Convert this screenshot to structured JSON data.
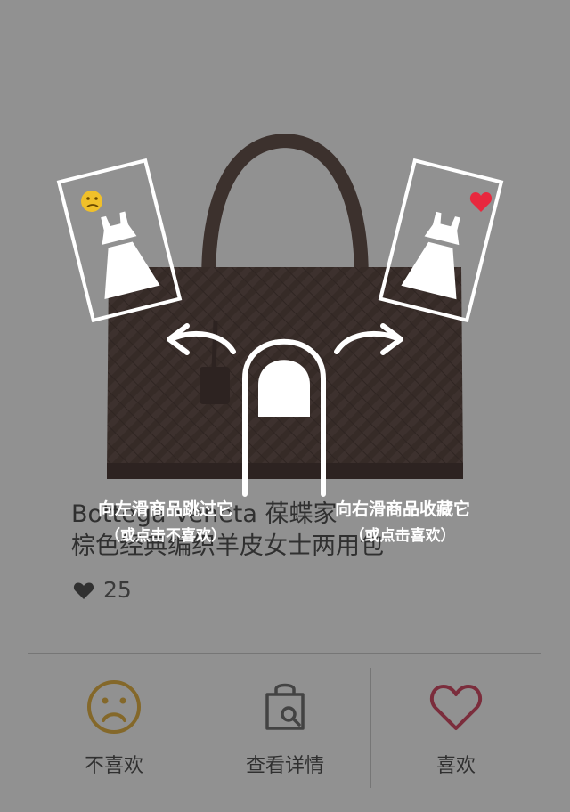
{
  "product": {
    "title_line1": "Bottega Veneta 葆蝶家",
    "title_line2": "棕色经典编织羊皮女士两用包",
    "like_count": "25",
    "image_icon": "woven-handbag"
  },
  "actions": {
    "dislike_label": "不喜欢",
    "details_label": "查看详情",
    "like_label": "喜欢"
  },
  "guide": {
    "left_hint": "向左滑商品跳过它",
    "left_sub": "（或点击不喜欢）",
    "right_hint": "向右滑商品收藏它",
    "right_sub": "（或点击喜欢）"
  },
  "colors": {
    "dislike": "#e8b84a",
    "like": "#e83a4e",
    "bag": "#6a5650",
    "overlay": "rgba(0,0,0,0.43)"
  }
}
